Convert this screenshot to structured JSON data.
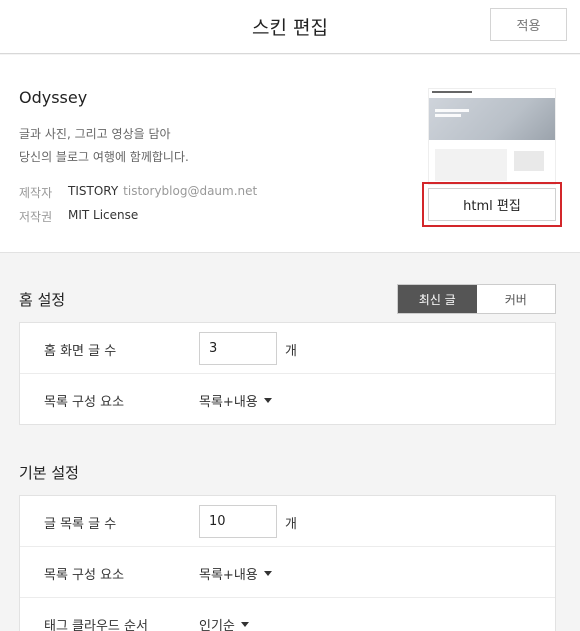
{
  "header": {
    "title": "스킨 편집",
    "apply_label": "적용"
  },
  "skin": {
    "name": "Odyssey",
    "description_line1": "글과 사진, 그리고 영상을 담아",
    "description_line2": "당신의 블로그 여행에 함께합니다.",
    "author_label": "제작자",
    "author_name": "TISTORY",
    "author_email": "tistoryblog@daum.net",
    "license_label": "저작권",
    "license_value": "MIT License",
    "html_edit_label": "html 편집"
  },
  "home_settings": {
    "title": "홈 설정",
    "toggle": {
      "options": [
        "최신 글",
        "커버"
      ],
      "active": "최신 글"
    },
    "rows": [
      {
        "label": "홈 화면 글 수",
        "value": "3",
        "unit": "개"
      },
      {
        "label": "목록 구성 요소",
        "select": "목록+내용"
      }
    ]
  },
  "basic_settings": {
    "title": "기본 설정",
    "rows": [
      {
        "label": "글 목록 글 수",
        "value": "10",
        "unit": "개"
      },
      {
        "label": "목록 구성 요소",
        "select": "목록+내용"
      },
      {
        "label": "태그 클라우드 순서",
        "select": "인기순"
      }
    ]
  },
  "colors": {
    "highlight": "#d3262a",
    "toggle_active": "#555555"
  }
}
